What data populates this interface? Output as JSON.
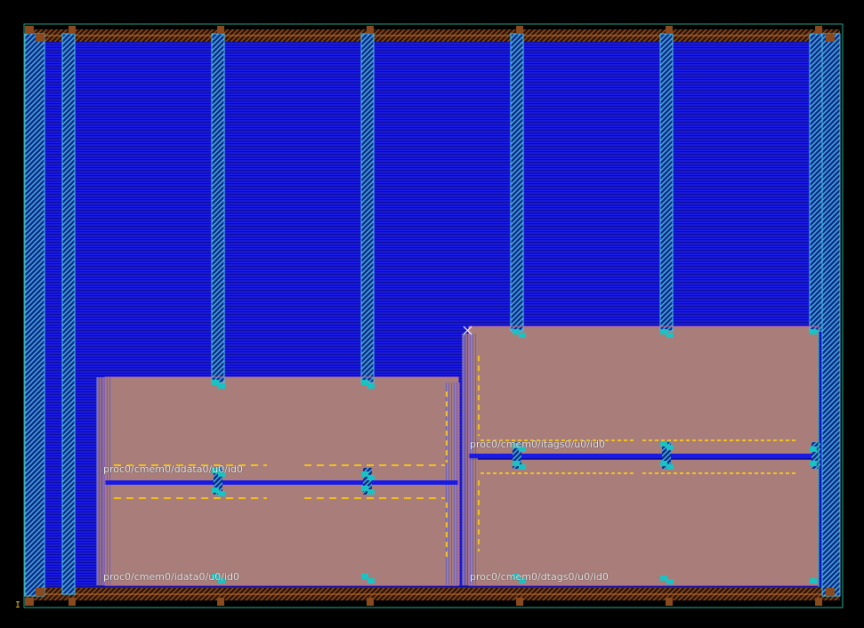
{
  "colors": {
    "background": "#000000",
    "metal_fill": "#1a1ae6",
    "metal_line": "#0000a8",
    "macro_fill": "#a97d7a",
    "power_stripe": "#4fc3e8",
    "ring": "#8a4a1e",
    "pin": "#19c3c3",
    "obstruction": "#f0c020",
    "edge": "#28a88c"
  },
  "macros": [
    {
      "id": "ddata",
      "label": "proc0/cmem0/ddata0/u0/id0"
    },
    {
      "id": "idata",
      "label": "proc0/cmem0/idata0/u0/id0"
    },
    {
      "id": "itags",
      "label": "proc0/cmem0/itags0/u0/id0"
    },
    {
      "id": "dtags",
      "label": "proc0/cmem0/dtags0/u0/id0"
    }
  ],
  "marker": "cross-marker",
  "origin_glyph": "I"
}
